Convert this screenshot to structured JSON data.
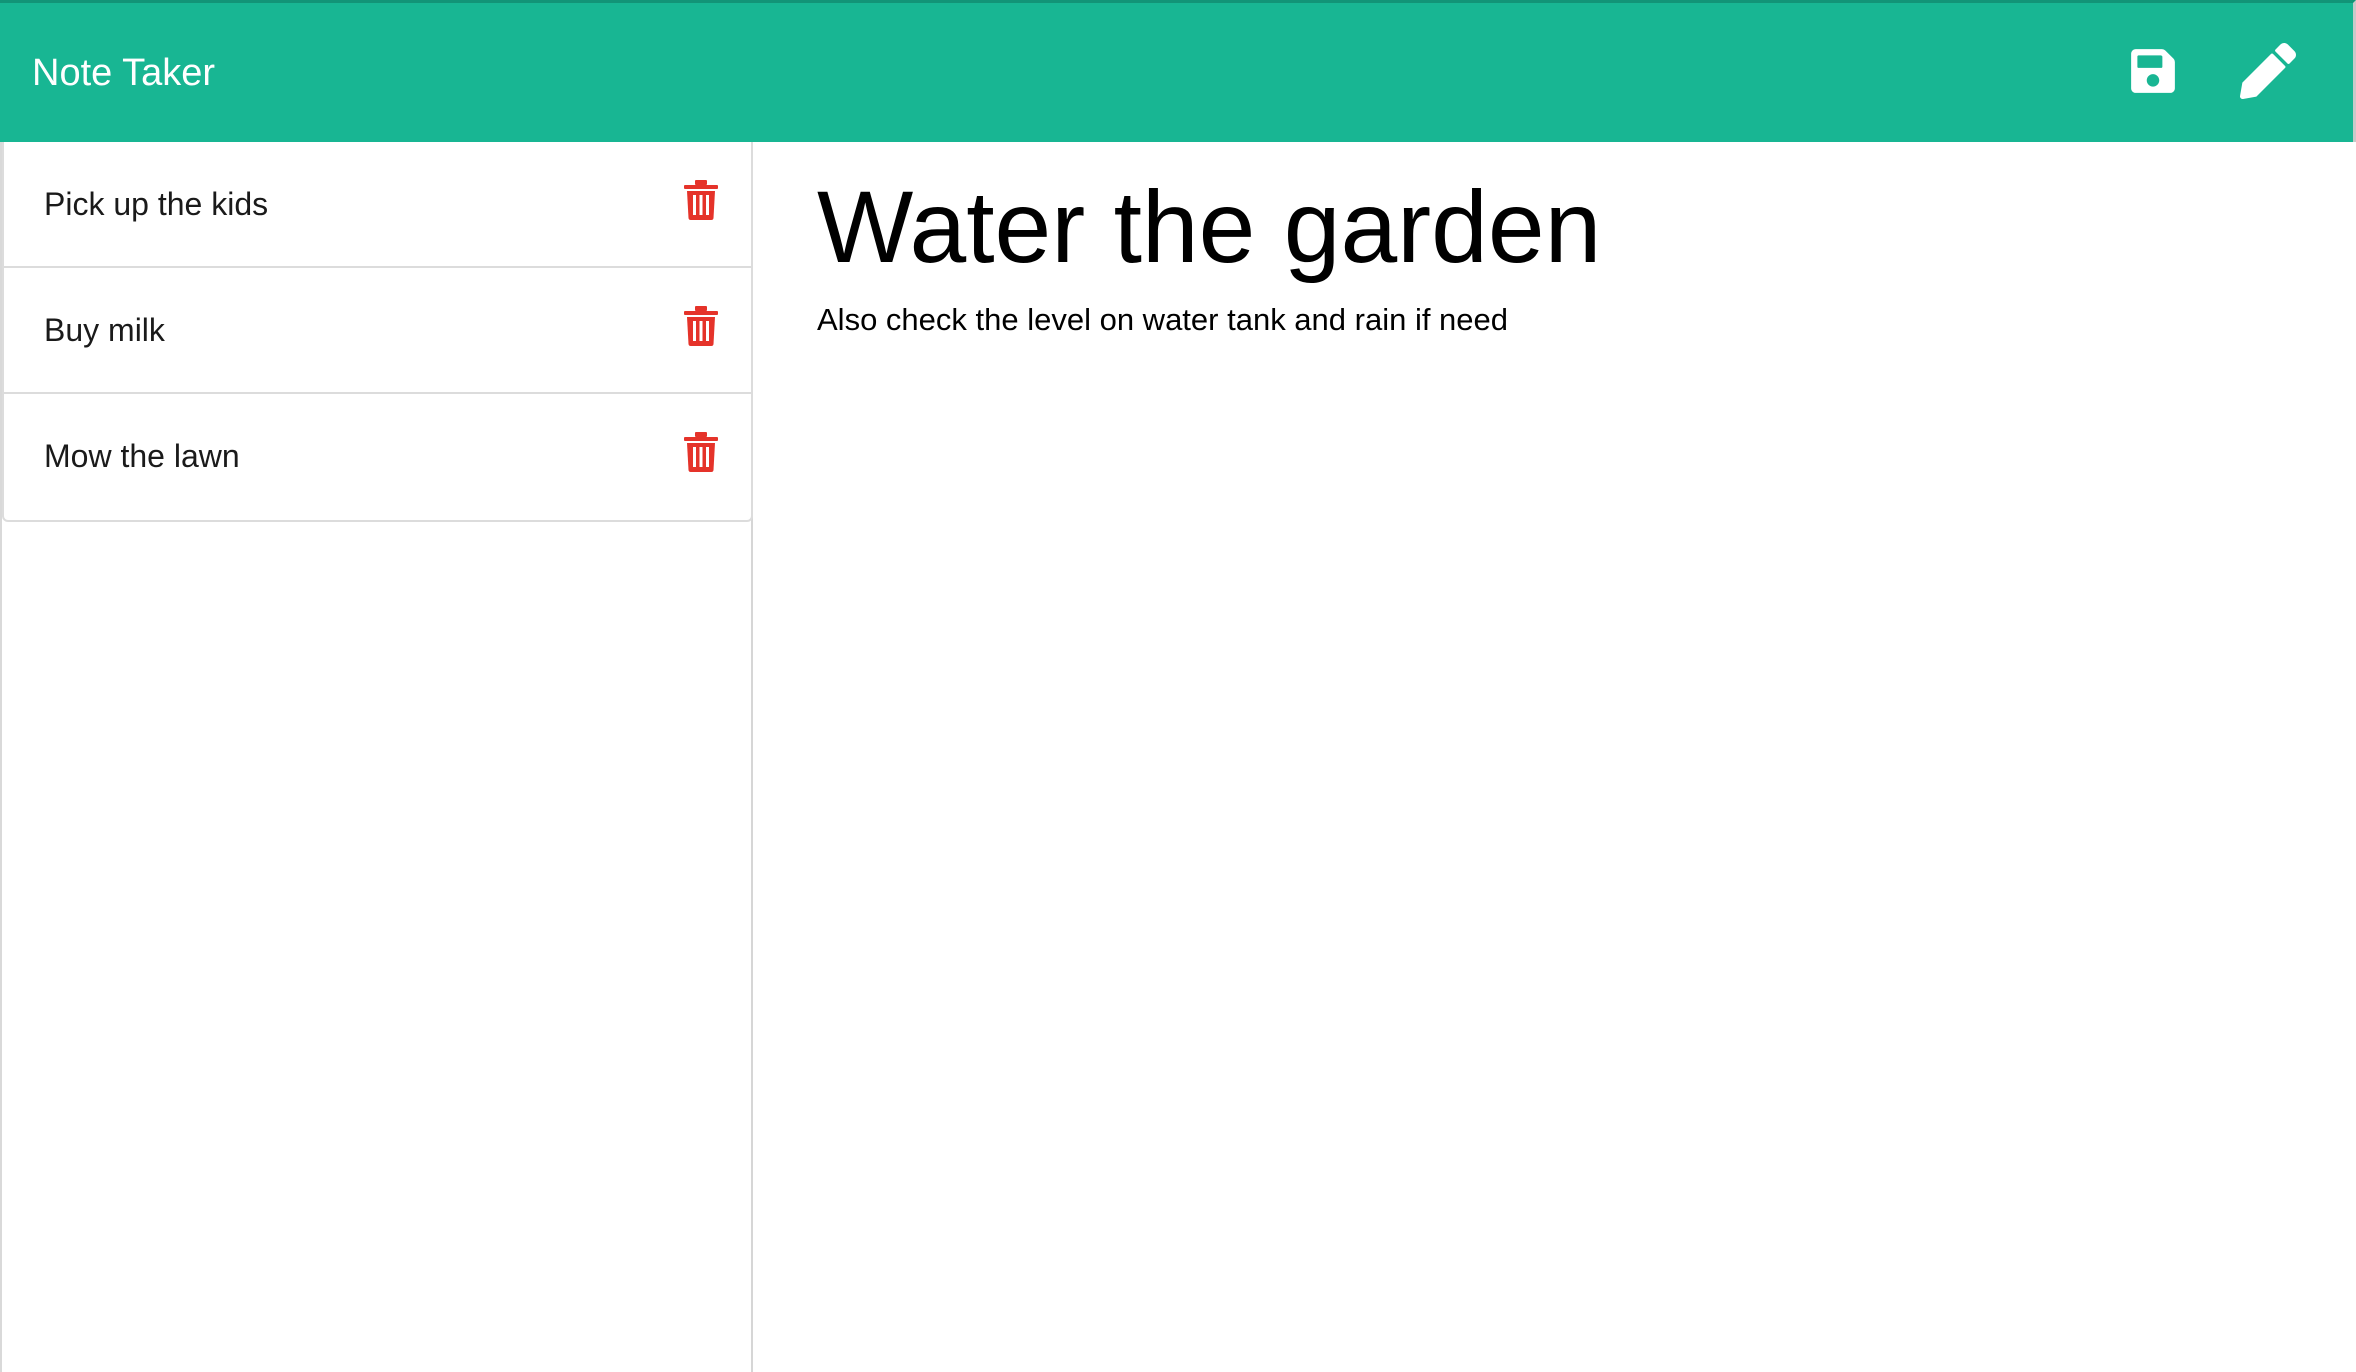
{
  "app": {
    "title": "Note Taker"
  },
  "navbar": {
    "background": "#18b693",
    "icons": {
      "save": "save-icon",
      "new_note": "pencil-icon"
    }
  },
  "sidebar": {
    "notes": [
      {
        "title": "Pick up the kids",
        "delete_icon": "trash-icon"
      },
      {
        "title": "Buy milk",
        "delete_icon": "trash-icon"
      },
      {
        "title": "Mow the lawn",
        "delete_icon": "trash-icon"
      }
    ],
    "delete_color": "#e5332a"
  },
  "editor": {
    "title": "Water the garden",
    "body": "Also check the level on water tank and rain if need"
  }
}
